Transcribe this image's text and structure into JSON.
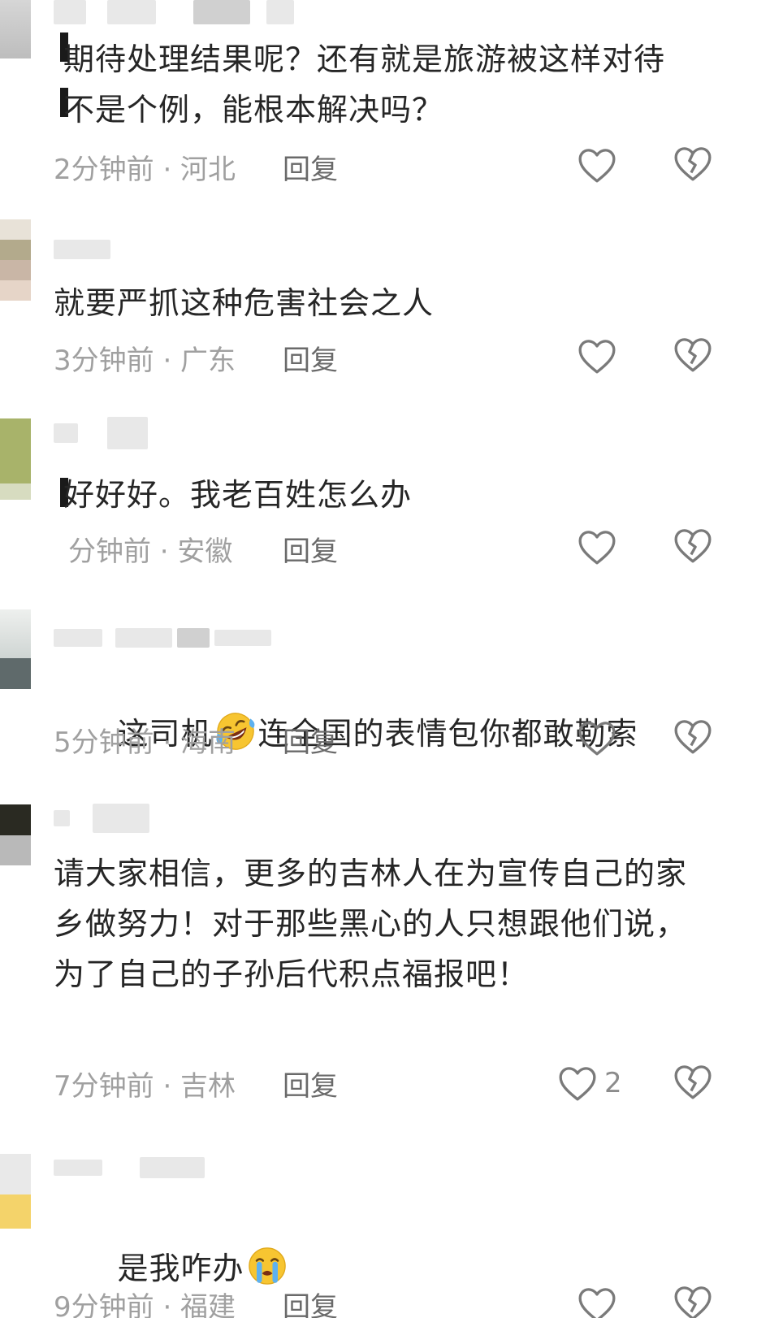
{
  "comments": [
    {
      "text": "期待处理结果呢？还有就是旅游被这样对待不是个例，能根本解决吗？",
      "time": "2分钟前 · 河北",
      "reply": "回复",
      "likes": ""
    },
    {
      "text": "就要严抓这种危害社会之人",
      "time": "3分钟前 · 广东",
      "reply": "回复",
      "likes": ""
    },
    {
      "text": "好好好。我老百姓怎么办",
      "time": "分钟前 · 安徽",
      "reply": "回复",
      "likes": ""
    },
    {
      "text_before_emoji": "这司机",
      "text_after_emoji": "连全国的表情包你都敢勒索",
      "time": "5分钟前 · 海南",
      "reply": "回复",
      "likes": ""
    },
    {
      "text": "请大家相信，更多的吉林人在为宣传自己的家乡做努力！对于那些黑心的人只想跟他们说，为了自己的子孙后代积点福报吧！",
      "time": "7分钟前 · 吉林",
      "reply": "回复",
      "likes": "2"
    },
    {
      "text_before_emoji": "是我咋办",
      "time": "9分钟前 · 福建",
      "reply": "回复",
      "likes": ""
    }
  ],
  "icons": {
    "like": "heart-outline-icon",
    "dislike": "broken-heart-icon",
    "emoji_laugh": "rolling-laughing-emoji",
    "emoji_cry": "crying-emoji"
  },
  "colors": {
    "text": "#262626",
    "meta": "#a0a0a0",
    "reply": "#6a6a6a",
    "icon": "#7a7a7a"
  }
}
